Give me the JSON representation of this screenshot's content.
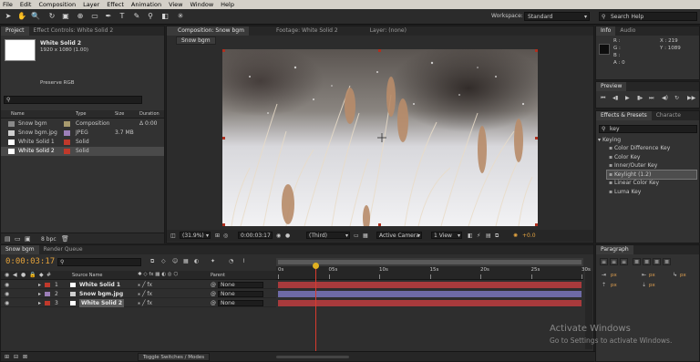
{
  "menu": [
    "File",
    "Edit",
    "Composition",
    "Layer",
    "Effect",
    "Animation",
    "View",
    "Window",
    "Help"
  ],
  "toolbar": {
    "workspace_label": "Workspace:",
    "workspace_value": "Standard",
    "search_placeholder": "Search Help"
  },
  "project_panel": {
    "tabs": [
      "Project",
      "Effect Controls: White Solid 2"
    ],
    "selected_name": "White Solid 2",
    "selected_info": "1920 x 1080 (1.00)",
    "preserve_rgb": "Preserve RGB",
    "columns": [
      "Name",
      "Type",
      "Size",
      "Duration"
    ],
    "items": [
      {
        "name": "Snow bgm",
        "type": "Composition",
        "size": "",
        "duration": "Δ 0:00",
        "color": "#a89b6e"
      },
      {
        "name": "Snow bgm.jpg",
        "type": "JPEG",
        "size": "3.7 MB",
        "duration": "",
        "color": "#9c7fb8"
      },
      {
        "name": "White Solid 1",
        "type": "Solid",
        "size": "",
        "duration": "",
        "color": "#c0392b"
      },
      {
        "name": "White Solid 2",
        "type": "Solid",
        "size": "",
        "duration": "",
        "color": "#c0392b"
      }
    ],
    "bpc": "8 bpc"
  },
  "comp_panel": {
    "tabs": [
      "Composition: Snow bgm",
      "Footage: White Solid 2",
      "Layer: (none)"
    ],
    "comp_button": "Snow bgm",
    "zoom": "(31.9%)",
    "timecode": "0:00:03:17",
    "resolution": "(Third)",
    "camera": "Active Camera",
    "views": "1 View",
    "exposure": "+0.0"
  },
  "info_panel": {
    "tabs": [
      "Info",
      "Audio"
    ],
    "r": "R :",
    "g": "G :",
    "b": "B :",
    "a": "A : 0",
    "x": "X : 219",
    "y": "Y : 1089"
  },
  "preview_panel": {
    "title": "Preview"
  },
  "effects_panel": {
    "tabs": [
      "Effects & Presets",
      "Characte"
    ],
    "search_value": "key",
    "category": "Keying",
    "items": [
      "Color Difference Key",
      "Color Key",
      "Inner/Outer Key",
      "Keylight (1.2)",
      "Linear Color Key",
      "Luma Key"
    ],
    "selected_index": 3
  },
  "paragraph_panel": {
    "title": "Paragraph",
    "values": [
      "px",
      "px",
      "px",
      "px",
      "px"
    ]
  },
  "timeline": {
    "tabs": [
      "Snow bgm",
      "Render Queue"
    ],
    "timecode": "0:00:03:17",
    "search_placeholder": "",
    "columns": {
      "source": "Source Name",
      "parent": "Parent"
    },
    "ruler": [
      "0s",
      "05s",
      "10s",
      "15s",
      "20s",
      "25s",
      "30s"
    ],
    "playhead_sec": 3.7,
    "duration_sec": 30,
    "layers": [
      {
        "num": "1",
        "name": "White Solid 1",
        "parent": "None",
        "color": "#c0392b",
        "bar_color": "#a83a3c"
      },
      {
        "num": "2",
        "name": "Snow bgm.jpg",
        "parent": "None",
        "color": "#9c7fb8",
        "bar_color": "#6e6aa6"
      },
      {
        "num": "3",
        "name": "White Solid 2",
        "parent": "None",
        "color": "#c0392b",
        "bar_color": "#a83a3c"
      }
    ],
    "toggle_label": "Toggle Switches / Modes"
  },
  "watermark": {
    "line1": "Activate Windows",
    "line2": "Go to Settings to activate Windows."
  }
}
